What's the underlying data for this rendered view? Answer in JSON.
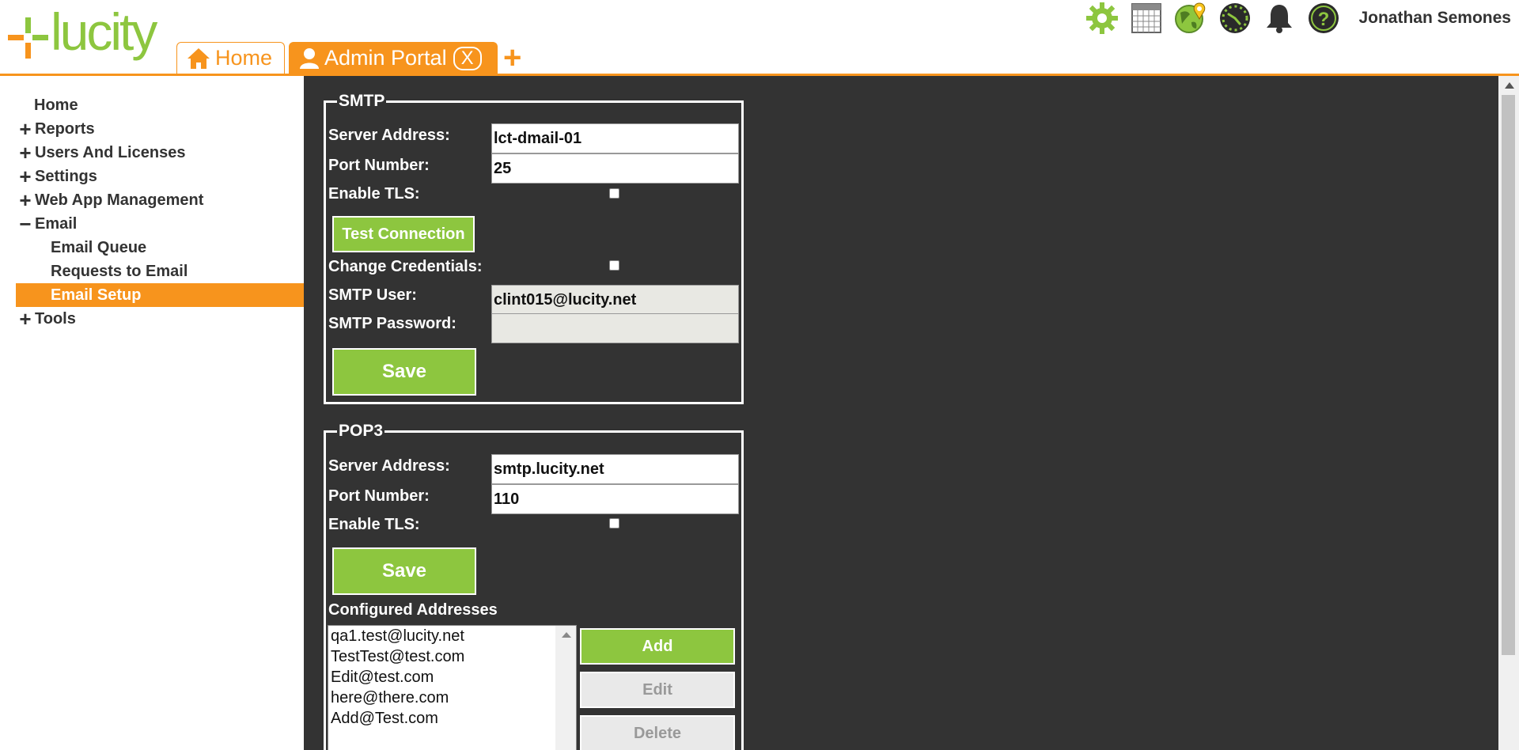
{
  "app": {
    "logo_text": "lucity"
  },
  "tabs": [
    {
      "label": "Home",
      "icon": "home-icon",
      "active": false
    },
    {
      "label": "Admin Portal",
      "icon": "user-icon",
      "active": true,
      "close_label": "X"
    }
  ],
  "tab_add_label": "+",
  "toolbar": {
    "icons": [
      "settings-gear-icon",
      "calendar-icon",
      "map-globe-icon",
      "dashboard-clock-icon",
      "notifications-bell-icon",
      "help-icon"
    ],
    "user_name": "Jonathan Semones"
  },
  "sidebar": {
    "home": "Home",
    "reports": "Reports",
    "users_licenses": "Users And Licenses",
    "settings": "Settings",
    "web_app": "Web App Management",
    "email": "Email",
    "email_queue": "Email Queue",
    "requests_to_email": "Requests to Email",
    "email_setup": "Email Setup",
    "tools": "Tools"
  },
  "smtp": {
    "legend": "SMTP",
    "server_label": "Server Address:",
    "server_value": "lct-dmail-01",
    "port_label": "Port Number:",
    "port_value": "25",
    "tls_label": "Enable TLS:",
    "tls_checked": false,
    "test_button": "Test Connection",
    "change_creds_label": "Change Credentials:",
    "change_creds_checked": false,
    "user_label": "SMTP User:",
    "user_value": "clint015@lucity.net",
    "password_label": "SMTP Password:",
    "password_value": "",
    "save_button": "Save"
  },
  "pop3": {
    "legend": "POP3",
    "server_label": "Server Address:",
    "server_value": "smtp.lucity.net",
    "port_label": "Port Number:",
    "port_value": "110",
    "tls_label": "Enable TLS:",
    "tls_checked": false,
    "save_button": "Save",
    "configured_label": "Configured Addresses",
    "addresses": [
      "qa1.test@lucity.net",
      "TestTest@test.com",
      "Edit@test.com",
      "here@there.com",
      "Add@Test.com"
    ],
    "add_button": "Add",
    "edit_button": "Edit",
    "delete_button": "Delete"
  },
  "colors": {
    "accent_orange": "#f7941d",
    "brand_green": "#8dc63f",
    "content_bg": "#333333"
  }
}
